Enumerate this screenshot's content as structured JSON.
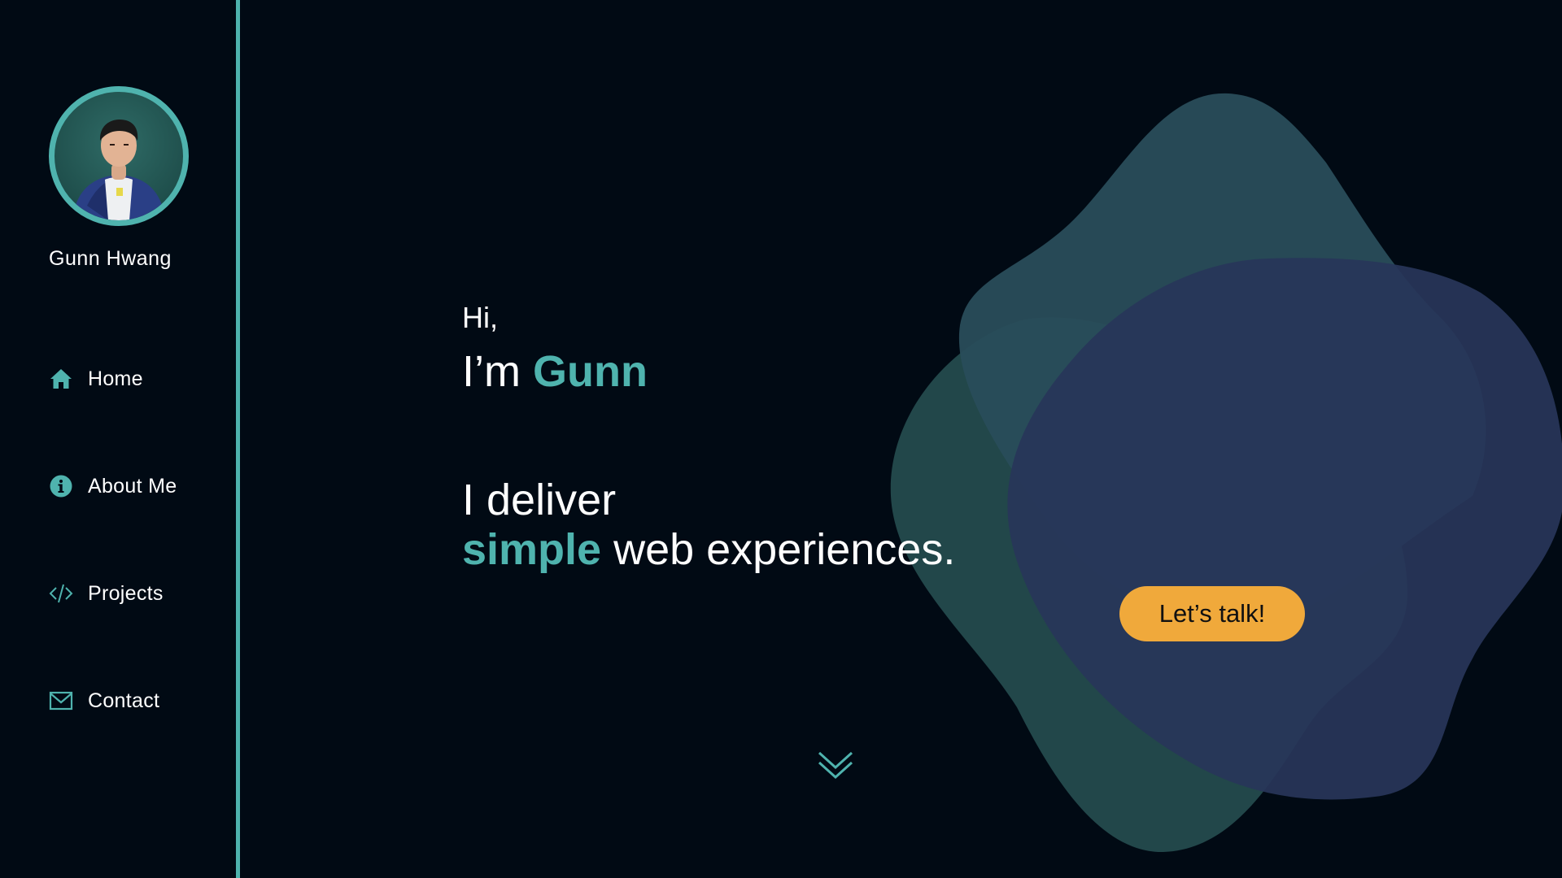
{
  "profile": {
    "name": "Gunn Hwang"
  },
  "nav": {
    "items": [
      {
        "label": "Home",
        "icon": "home-icon"
      },
      {
        "label": "About Me",
        "icon": "info-icon"
      },
      {
        "label": "Projects",
        "icon": "code-icon"
      },
      {
        "label": "Contact",
        "icon": "mail-icon"
      }
    ]
  },
  "hero": {
    "greeting": "Hi,",
    "intro_prefix": "I’m ",
    "intro_name": "Gunn",
    "tagline_line1": "I deliver",
    "tagline_accent": "simple",
    "tagline_rest": " web experiences.",
    "cta_label": "Let’s talk!",
    "scroll_icon": "double-chevron-down-icon"
  },
  "colors": {
    "background": "#010a14",
    "accent": "#4fb3ae",
    "cta": "#f0a93b",
    "blob_teal": "#2a5a5a",
    "blob_navy": "#26335a"
  }
}
